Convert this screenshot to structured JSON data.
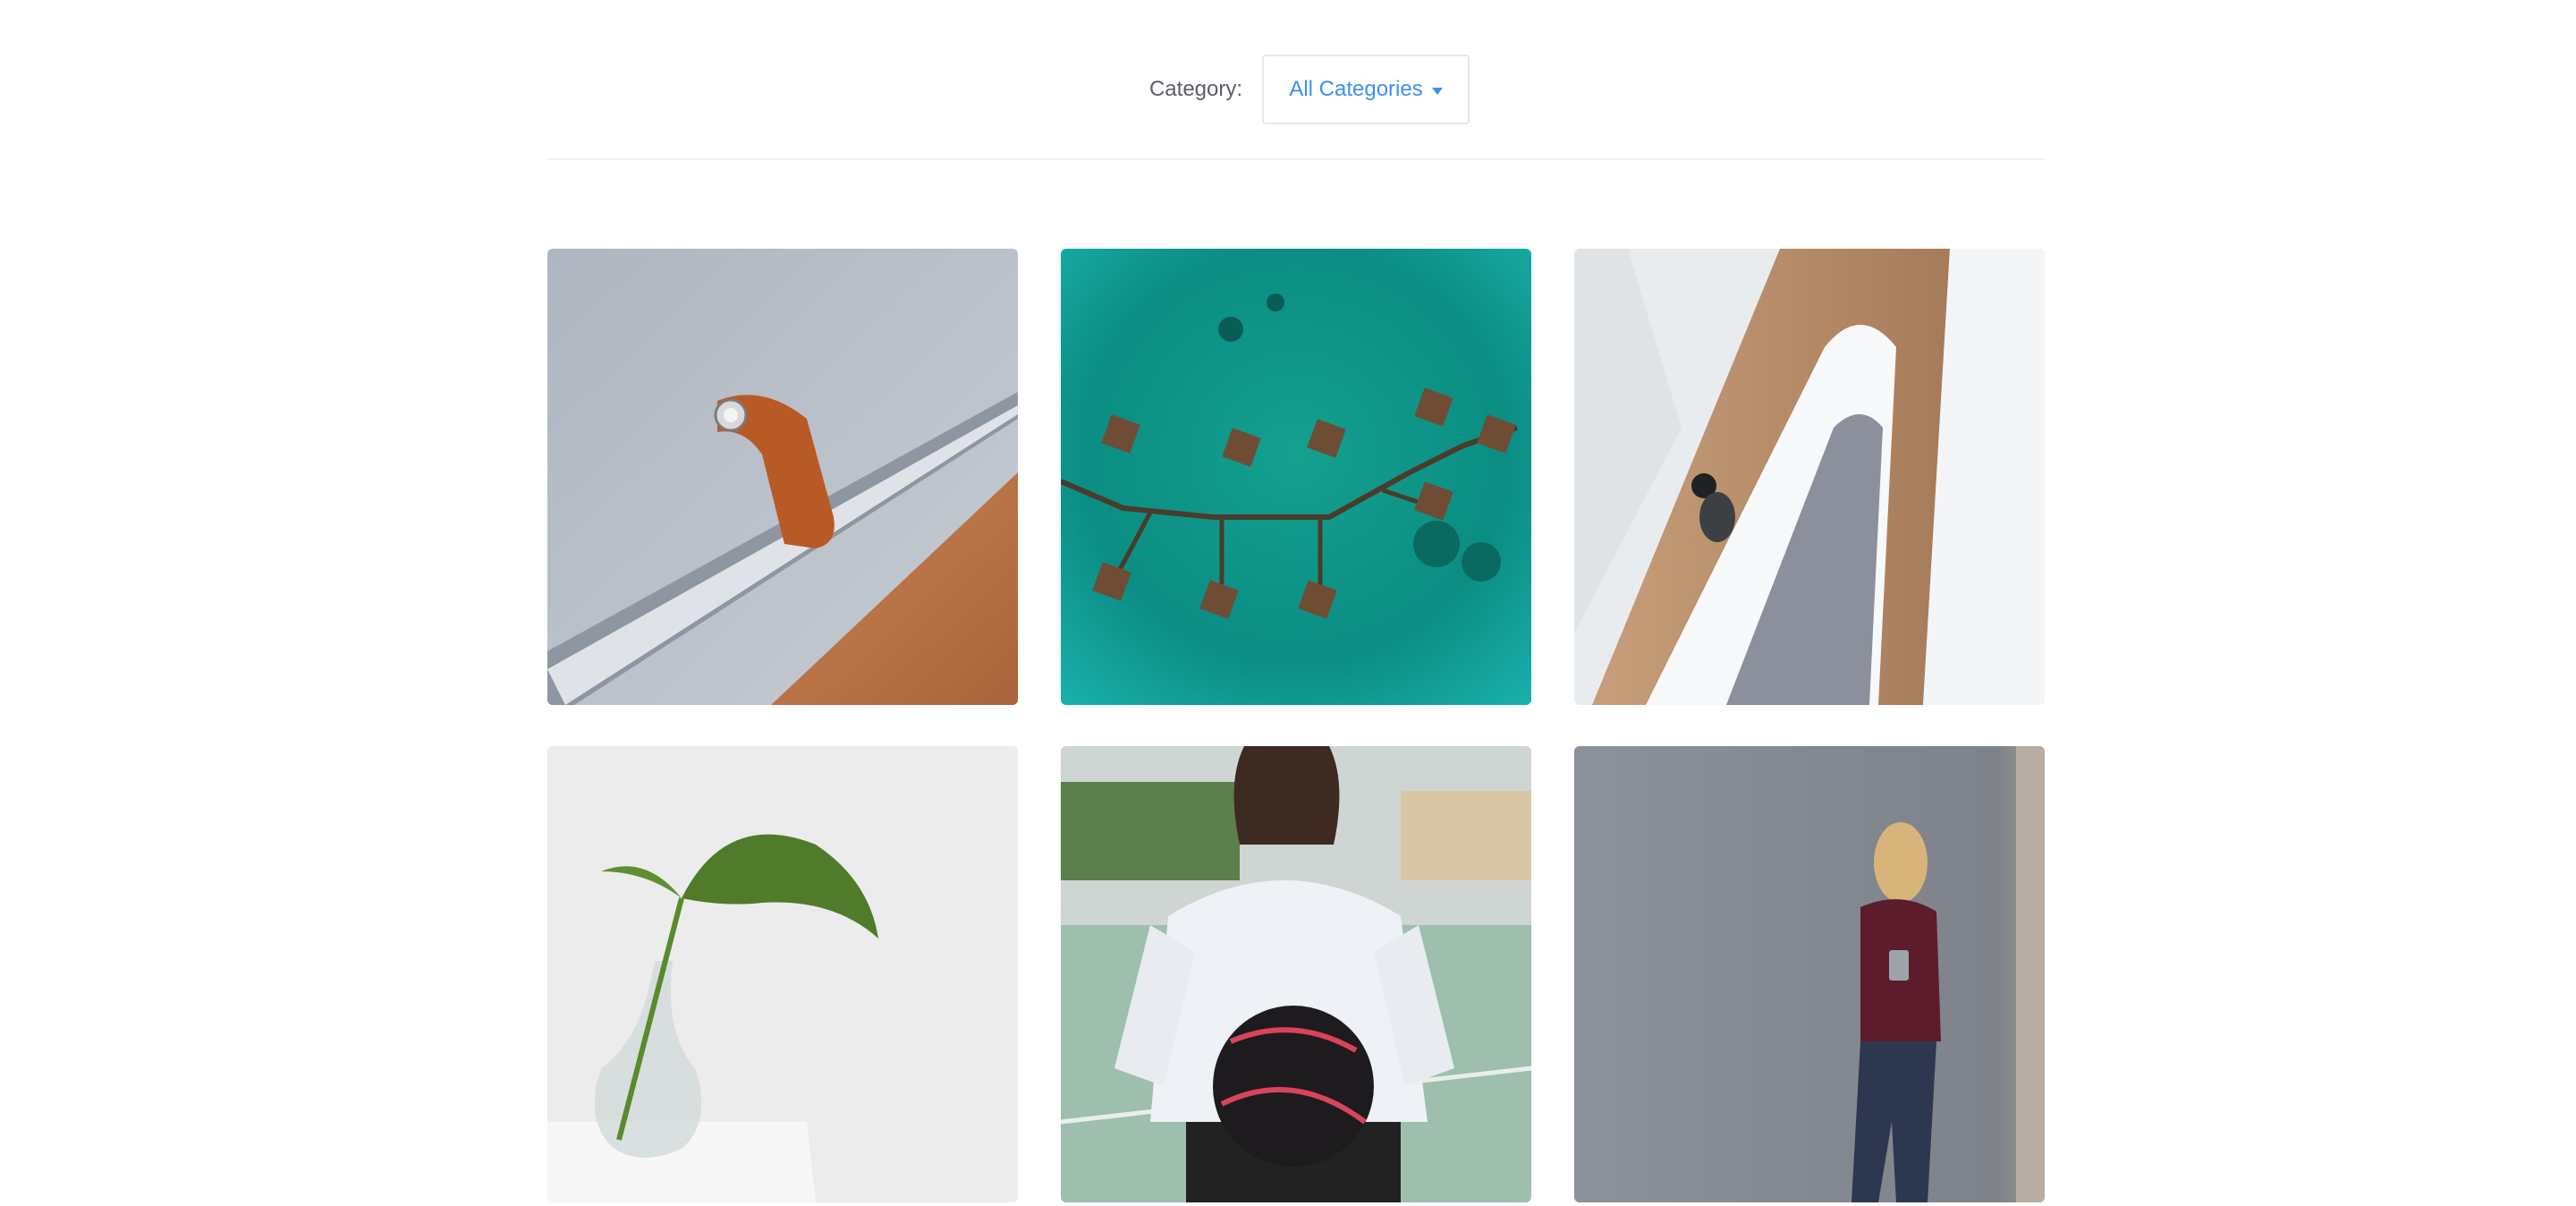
{
  "filter": {
    "label": "Category:",
    "selected": "All Categories",
    "icon": "caret-down-icon"
  },
  "gallery": {
    "items": [
      {
        "subject": "felt laptop sleeve with leather strap",
        "icon": "photo"
      },
      {
        "subject": "aerial view of overwater bungalows",
        "icon": "photo"
      },
      {
        "subject": "person on spiral staircase from above",
        "icon": "photo"
      },
      {
        "subject": "monstera leaf in glass vase",
        "icon": "photo"
      },
      {
        "subject": "basketball player holding ball",
        "icon": "photo"
      },
      {
        "subject": "woman leaning on grey wall with phone",
        "icon": "photo"
      }
    ]
  },
  "colors": {
    "accent": "#3f8ef0",
    "label": "#5a5f66",
    "border": "#e3e7ec"
  }
}
